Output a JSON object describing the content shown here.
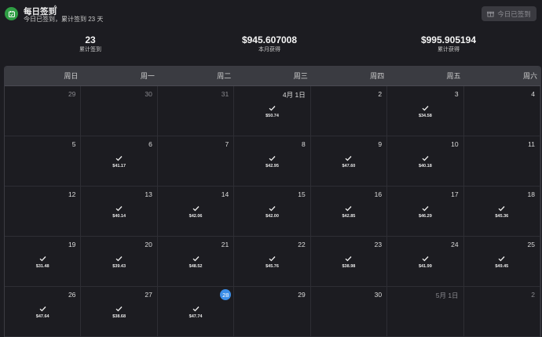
{
  "header": {
    "title": "每日签到",
    "subtitle": "今日已签到，累计签到 23 天",
    "checkin_button": "今日已签到"
  },
  "stats": [
    {
      "value": "23",
      "label": "累计签到"
    },
    {
      "value": "$945.607008",
      "label": "本月获得"
    },
    {
      "value": "$995.905194",
      "label": "累计获得"
    }
  ],
  "weekdays": [
    "周日",
    "周一",
    "周二",
    "周三",
    "周四",
    "周五",
    "周六"
  ],
  "days": [
    {
      "label": "29",
      "other": true
    },
    {
      "label": "30",
      "other": true
    },
    {
      "label": "31",
      "other": true
    },
    {
      "label": "4月 1日",
      "checked": true,
      "amount": "$50.74"
    },
    {
      "label": "2"
    },
    {
      "label": "3",
      "checked": true,
      "amount": "$34.58"
    },
    {
      "label": "4"
    },
    {
      "label": "5"
    },
    {
      "label": "6",
      "checked": true,
      "amount": "$41.17"
    },
    {
      "label": "7"
    },
    {
      "label": "8",
      "checked": true,
      "amount": "$42.95"
    },
    {
      "label": "9",
      "checked": true,
      "amount": "$47.60"
    },
    {
      "label": "10",
      "checked": true,
      "amount": "$40.18"
    },
    {
      "label": "11"
    },
    {
      "label": "12"
    },
    {
      "label": "13",
      "checked": true,
      "amount": "$40.14"
    },
    {
      "label": "14",
      "checked": true,
      "amount": "$42.06"
    },
    {
      "label": "15",
      "checked": true,
      "amount": "$42.00"
    },
    {
      "label": "16",
      "checked": true,
      "amount": "$42.85"
    },
    {
      "label": "17",
      "checked": true,
      "amount": "$46.29"
    },
    {
      "label": "18",
      "checked": true,
      "amount": "$45.36"
    },
    {
      "label": "19",
      "checked": true,
      "amount": "$31.48"
    },
    {
      "label": "20",
      "checked": true,
      "amount": "$39.43"
    },
    {
      "label": "21",
      "checked": true,
      "amount": "$48.52"
    },
    {
      "label": "22",
      "checked": true,
      "amount": "$45.76"
    },
    {
      "label": "23",
      "checked": true,
      "amount": "$38.98"
    },
    {
      "label": "24",
      "checked": true,
      "amount": "$41.99"
    },
    {
      "label": "25",
      "checked": true,
      "amount": "$49.45"
    },
    {
      "label": "26",
      "checked": true,
      "amount": "$47.64"
    },
    {
      "label": "27",
      "checked": true,
      "amount": "$38.68"
    },
    {
      "label": "28",
      "today": true,
      "checked": true,
      "amount": "$47.74"
    },
    {
      "label": "29"
    },
    {
      "label": "30"
    },
    {
      "label": "5月 1日",
      "other": true
    },
    {
      "label": "2",
      "other": true
    }
  ],
  "colors": {
    "accent": "#3b8ee8",
    "app_icon": "#2f9e44"
  }
}
